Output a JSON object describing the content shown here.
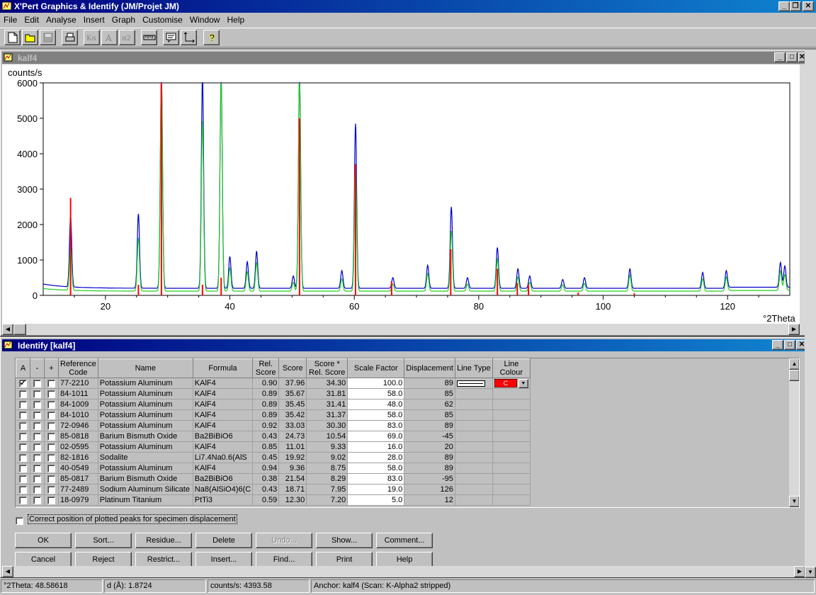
{
  "app": {
    "title": "X'Pert Graphics & Identify (JM/Projet JM)",
    "menu": [
      "File",
      "Edit",
      "Analyse",
      "Insert",
      "Graph",
      "Customise",
      "Window",
      "Help"
    ]
  },
  "plot_window": {
    "title": "kalf4",
    "ylabel": "counts/s",
    "xlabel": "°2Theta"
  },
  "chart_data": {
    "type": "line",
    "xlabel": "°2Theta",
    "ylabel": "counts/s",
    "xlim": [
      10,
      130
    ],
    "ylim": [
      0,
      6000
    ],
    "x_ticks": [
      20,
      40,
      60,
      80,
      100,
      120
    ],
    "y_ticks": [
      0,
      1000,
      2000,
      3000,
      4000,
      5000,
      6000
    ],
    "series": [
      {
        "color": "#0000cc",
        "background": 200,
        "peaks": [
          [
            14.4,
            2000
          ],
          [
            25.3,
            2100
          ],
          [
            29.0,
            6000
          ],
          [
            35.6,
            6000
          ],
          [
            38.6,
            6000
          ],
          [
            40.0,
            900
          ],
          [
            42.8,
            750
          ],
          [
            44.3,
            1050
          ],
          [
            50.2,
            350
          ],
          [
            51.2,
            6000
          ],
          [
            58.0,
            500
          ],
          [
            60.2,
            4650
          ],
          [
            66.2,
            300
          ],
          [
            71.8,
            650
          ],
          [
            75.6,
            2300
          ],
          [
            78.2,
            300
          ],
          [
            83.0,
            1150
          ],
          [
            86.3,
            550
          ],
          [
            88.2,
            350
          ],
          [
            93.5,
            250
          ],
          [
            97.0,
            300
          ],
          [
            104.3,
            550
          ],
          [
            116.0,
            450
          ],
          [
            119.8,
            500
          ],
          [
            128.5,
            700
          ],
          [
            129.2,
            600
          ]
        ]
      },
      {
        "color": "#22cc22",
        "background": 120,
        "peaks": [
          [
            14.4,
            1300
          ],
          [
            25.3,
            1500
          ],
          [
            29.0,
            6000
          ],
          [
            35.6,
            4800
          ],
          [
            38.6,
            6000
          ],
          [
            40.0,
            650
          ],
          [
            42.8,
            550
          ],
          [
            44.3,
            800
          ],
          [
            50.2,
            250
          ],
          [
            51.2,
            6000
          ],
          [
            58.0,
            350
          ],
          [
            60.2,
            3600
          ],
          [
            66.2,
            200
          ],
          [
            71.8,
            500
          ],
          [
            75.6,
            1700
          ],
          [
            78.2,
            200
          ],
          [
            83.0,
            900
          ],
          [
            86.3,
            400
          ],
          [
            88.2,
            250
          ],
          [
            93.5,
            180
          ],
          [
            97.0,
            220
          ],
          [
            104.3,
            450
          ],
          [
            116.0,
            350
          ],
          [
            119.8,
            400
          ],
          [
            128.5,
            550
          ],
          [
            129.2,
            450
          ]
        ]
      },
      {
        "color": "#ff0000",
        "type": "sticks",
        "sticks": [
          [
            14.4,
            2750
          ],
          [
            25.3,
            300
          ],
          [
            29.0,
            6000
          ],
          [
            35.6,
            300
          ],
          [
            38.6,
            500
          ],
          [
            51.2,
            5000
          ],
          [
            60.2,
            3700
          ],
          [
            66.0,
            400
          ],
          [
            75.5,
            1300
          ],
          [
            83.0,
            750
          ],
          [
            86.2,
            350
          ],
          [
            88.0,
            300
          ],
          [
            96.0,
            80
          ],
          [
            105.0,
            60
          ]
        ]
      }
    ]
  },
  "identify_window": {
    "title": "Identify [kalf4]",
    "headers": [
      "A",
      "-",
      "+",
      "Reference Code",
      "Name",
      "Formula",
      "Rel. Score",
      "Score",
      "Score * Rel. Score",
      "Scale Factor",
      "Displacement",
      "Line Type",
      "Line Colour"
    ],
    "rows": [
      {
        "a": true,
        "ref": "77-2210",
        "name": "Potassium Aluminum",
        "formula": "KAlF4",
        "rel": "0.90",
        "score": "37.96",
        "sxr": "34.30",
        "scale": "100.0",
        "disp": "89"
      },
      {
        "a": false,
        "ref": "84-1011",
        "name": "Potassium Aluminum",
        "formula": "KAlF4",
        "rel": "0.89",
        "score": "35.67",
        "sxr": "31.81",
        "scale": "58.0",
        "disp": "85"
      },
      {
        "a": false,
        "ref": "84-1009",
        "name": "Potassium Aluminum",
        "formula": "KAlF4",
        "rel": "0.89",
        "score": "35.45",
        "sxr": "31.41",
        "scale": "48.0",
        "disp": "62"
      },
      {
        "a": false,
        "ref": "84-1010",
        "name": "Potassium Aluminum",
        "formula": "KAlF4",
        "rel": "0.89",
        "score": "35.42",
        "sxr": "31.37",
        "scale": "58.0",
        "disp": "85"
      },
      {
        "a": false,
        "ref": "72-0946",
        "name": "Potassium Aluminum",
        "formula": "KAlF4",
        "rel": "0.92",
        "score": "33.03",
        "sxr": "30.30",
        "scale": "83.0",
        "disp": "89"
      },
      {
        "a": false,
        "ref": "85-0818",
        "name": "Barium Bismuth Oxide",
        "formula": "Ba2BiBiO6",
        "rel": "0.43",
        "score": "24.73",
        "sxr": "10.54",
        "scale": "69.0",
        "disp": "-45"
      },
      {
        "a": false,
        "ref": "02-0595",
        "name": "Potassium Aluminum",
        "formula": "KAlF4",
        "rel": "0.85",
        "score": "11.01",
        "sxr": "9.33",
        "scale": "16.0",
        "disp": "20"
      },
      {
        "a": false,
        "ref": "82-1816",
        "name": "Sodalite",
        "formula": "Li7.4Na0.6(AlS",
        "rel": "0.45",
        "score": "19.92",
        "sxr": "9.02",
        "scale": "28.0",
        "disp": "89"
      },
      {
        "a": false,
        "ref": "40-0549",
        "name": "Potassium Aluminum",
        "formula": "KAlF4",
        "rel": "0.94",
        "score": "9.36",
        "sxr": "8.75",
        "scale": "58.0",
        "disp": "89"
      },
      {
        "a": false,
        "ref": "85-0817",
        "name": "Barium Bismuth Oxide",
        "formula": "Ba2BiBiO6",
        "rel": "0.38",
        "score": "21.54",
        "sxr": "8.29",
        "scale": "83.0",
        "disp": "-95"
      },
      {
        "a": false,
        "ref": "77-2489",
        "name": "Sodium Aluminum Silicate",
        "formula": "Na8(AlSiO4)6(C",
        "rel": "0.43",
        "score": "18.71",
        "sxr": "7.95",
        "scale": "19.0",
        "disp": "126"
      },
      {
        "a": false,
        "ref": "18-0979",
        "name": "Platinum Titanium",
        "formula": "PtTi3",
        "rel": "0.59",
        "score": "12.30",
        "sxr": "7.20",
        "scale": "5.0",
        "disp": "12"
      }
    ],
    "line_colour_first": "#ff0000",
    "line_colour_text": "C",
    "correct_label": "Correct position of plotted peaks for specimen displacement",
    "buttons_row1": [
      "OK",
      "Sort...",
      "Residue...",
      "Delete",
      "Undo...",
      "Show...",
      "Comment..."
    ],
    "buttons_row2": [
      "Cancel",
      "Reject",
      "Restrict...",
      "Insert...",
      "Find...",
      "Print",
      "Help"
    ]
  },
  "status": {
    "theta": "°2Theta: 48.58618",
    "d": "d (Å): 1.8724",
    "counts": "counts/s: 4393.58",
    "anchor": "Anchor: kalf4   (Scan: K-Alpha2 stripped)"
  }
}
